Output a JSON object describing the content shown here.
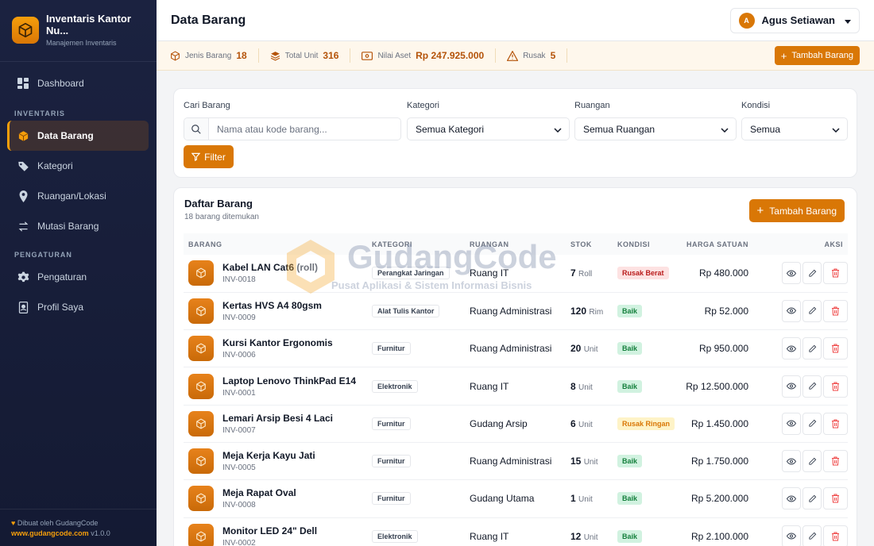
{
  "brand": {
    "title": "Inventaris Kantor Nu...",
    "subtitle": "Manajemen Inventaris"
  },
  "sidebar": {
    "dashboard": "Dashboard",
    "section_inventaris": "INVENTARIS",
    "items": [
      {
        "label": "Data Barang",
        "icon": "box-icon",
        "active": true
      },
      {
        "label": "Kategori",
        "icon": "tag-icon"
      },
      {
        "label": "Ruangan/Lokasi",
        "icon": "map-pin-icon"
      },
      {
        "label": "Mutasi Barang",
        "icon": "transfer-icon"
      }
    ],
    "section_pengaturan": "PENGATURAN",
    "settings": [
      {
        "label": "Pengaturan",
        "icon": "gear-icon"
      },
      {
        "label": "Profil Saya",
        "icon": "id-badge-icon"
      }
    ],
    "footer_credit": "Dibuat oleh GudangCode",
    "footer_url": "www.gudangcode.com",
    "footer_version": "v1.0.0"
  },
  "header": {
    "title": "Data Barang",
    "user_initial": "A",
    "user_name": "Agus Setiawan"
  },
  "stats": {
    "jenis_label": "Jenis Barang",
    "jenis_value": "18",
    "unit_label": "Total Unit",
    "unit_value": "316",
    "aset_label": "Nilai Aset",
    "aset_value": "Rp 247.925.000",
    "rusak_label": "Rusak",
    "rusak_value": "5",
    "add_label": "Tambah Barang"
  },
  "filters": {
    "search_label": "Cari Barang",
    "search_placeholder": "Nama atau kode barang...",
    "kategori_label": "Kategori",
    "kategori_value": "Semua Kategori",
    "ruangan_label": "Ruangan",
    "ruangan_value": "Semua Ruangan",
    "kondisi_label": "Kondisi",
    "kondisi_value": "Semua",
    "filter_button": "Filter"
  },
  "list": {
    "title": "Daftar Barang",
    "subtitle": "18 barang ditemukan",
    "add_button": "Tambah Barang",
    "columns": [
      "BARANG",
      "KATEGORI",
      "RUANGAN",
      "STOK",
      "KONDISI",
      "HARGA SATUAN",
      "AKSI"
    ],
    "rows": [
      {
        "name": "Kabel LAN Cat6 (roll)",
        "code": "INV-0018",
        "category": "Perangkat Jaringan",
        "room": "Ruang IT",
        "stock": "7",
        "unit": "Roll",
        "condition": "Rusak Berat",
        "cond_type": "berat",
        "price": "Rp 480.000"
      },
      {
        "name": "Kertas HVS A4 80gsm",
        "code": "INV-0009",
        "category": "Alat Tulis Kantor",
        "room": "Ruang Administrasi",
        "stock": "120",
        "unit": "Rim",
        "condition": "Baik",
        "cond_type": "baik",
        "price": "Rp 52.000"
      },
      {
        "name": "Kursi Kantor Ergonomis",
        "code": "INV-0006",
        "category": "Furnitur",
        "room": "Ruang Administrasi",
        "stock": "20",
        "unit": "Unit",
        "condition": "Baik",
        "cond_type": "baik",
        "price": "Rp 950.000"
      },
      {
        "name": "Laptop Lenovo ThinkPad E14",
        "code": "INV-0001",
        "category": "Elektronik",
        "room": "Ruang IT",
        "stock": "8",
        "unit": "Unit",
        "condition": "Baik",
        "cond_type": "baik",
        "price": "Rp 12.500.000"
      },
      {
        "name": "Lemari Arsip Besi 4 Laci",
        "code": "INV-0007",
        "category": "Furnitur",
        "room": "Gudang Arsip",
        "stock": "6",
        "unit": "Unit",
        "condition": "Rusak Ringan",
        "cond_type": "ringan",
        "price": "Rp 1.450.000"
      },
      {
        "name": "Meja Kerja Kayu Jati",
        "code": "INV-0005",
        "category": "Furnitur",
        "room": "Ruang Administrasi",
        "stock": "15",
        "unit": "Unit",
        "condition": "Baik",
        "cond_type": "baik",
        "price": "Rp 1.750.000"
      },
      {
        "name": "Meja Rapat Oval",
        "code": "INV-0008",
        "category": "Furnitur",
        "room": "Gudang Utama",
        "stock": "1",
        "unit": "Unit",
        "condition": "Baik",
        "cond_type": "baik",
        "price": "Rp 5.200.000"
      },
      {
        "name": "Monitor LED 24\" Dell",
        "code": "INV-0002",
        "category": "Elektronik",
        "room": "Ruang IT",
        "stock": "12",
        "unit": "Unit",
        "condition": "Baik",
        "cond_type": "baik",
        "price": "Rp 2.100.000"
      }
    ]
  },
  "watermark": {
    "title": "GudangCode",
    "tagline": "Pusat Aplikasi & Sistem Informasi Bisnis"
  }
}
